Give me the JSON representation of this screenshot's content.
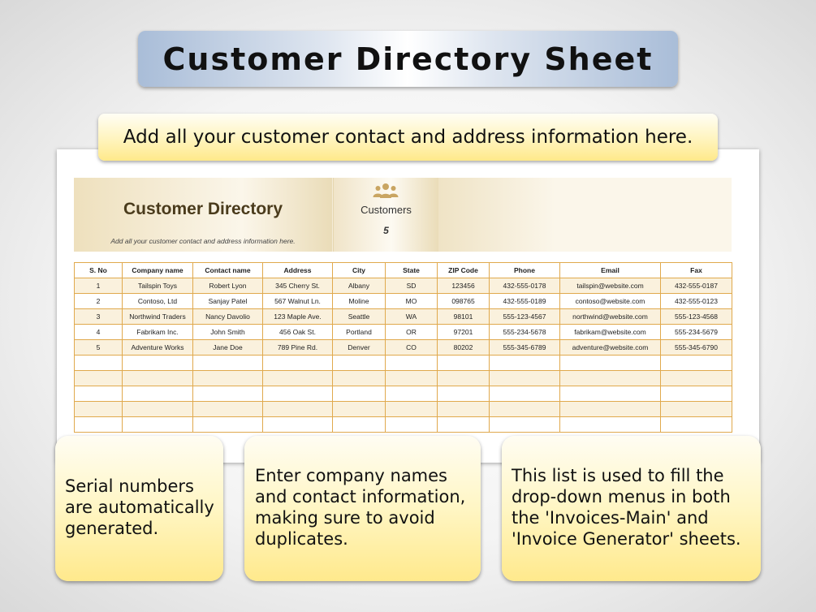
{
  "title_banner": {
    "text": "Customer Directory Sheet"
  },
  "subtitle": {
    "text": "Add all your customer contact and address information here."
  },
  "directory": {
    "title": "Customer Directory",
    "note": "Add all your customer contact and address information here.",
    "count_label": "Customers",
    "count_value": "5",
    "count_icon": "people-group-icon"
  },
  "table": {
    "headers": [
      "S. No",
      "Company name",
      "Contact name",
      "Address",
      "City",
      "State",
      "ZIP Code",
      "Phone",
      "Email",
      "Fax"
    ],
    "rows": [
      [
        "1",
        "Tailspin Toys",
        "Robert Lyon",
        "345 Cherry St.",
        "Albany",
        "SD",
        "123456",
        "432-555-0178",
        "tailspin@website.com",
        "432-555-0187"
      ],
      [
        "2",
        "Contoso, Ltd",
        "Sanjay Patel",
        "567 Walnut Ln.",
        "Moline",
        "MO",
        "098765",
        "432-555-0189",
        "contoso@website.com",
        "432-555-0123"
      ],
      [
        "3",
        "Northwind Traders",
        "Nancy Davolio",
        "123 Maple Ave.",
        "Seattle",
        "WA",
        "98101",
        "555-123-4567",
        "northwind@website.com",
        "555-123-4568"
      ],
      [
        "4",
        "Fabrikam Inc.",
        "John Smith",
        "456 Oak St.",
        "Portland",
        "OR",
        "97201",
        "555-234-5678",
        "fabrikam@website.com",
        "555-234-5679"
      ],
      [
        "5",
        "Adventure Works",
        "Jane Doe",
        "789 Pine Rd.",
        "Denver",
        "CO",
        "80202",
        "555-345-6789",
        "adventure@website.com",
        "555-345-6790"
      ]
    ],
    "empty_row_count": 5
  },
  "callouts": [
    {
      "text": "Serial numbers are automatically generated."
    },
    {
      "text": "Enter company names and contact information, making sure to avoid duplicates."
    },
    {
      "text": "This list is used to fill the drop-down menus in both the 'Invoices-Main' and 'Invoice Generator' sheets."
    }
  ],
  "colors": {
    "banner_blue": "#a9bdd8",
    "callout_yellow": "#ffe98c",
    "grid_orange": "#e0a94d",
    "row_shade": "#faf1dd",
    "header_tan": "#f5ecd8",
    "title_brown": "#4a3b1c"
  }
}
